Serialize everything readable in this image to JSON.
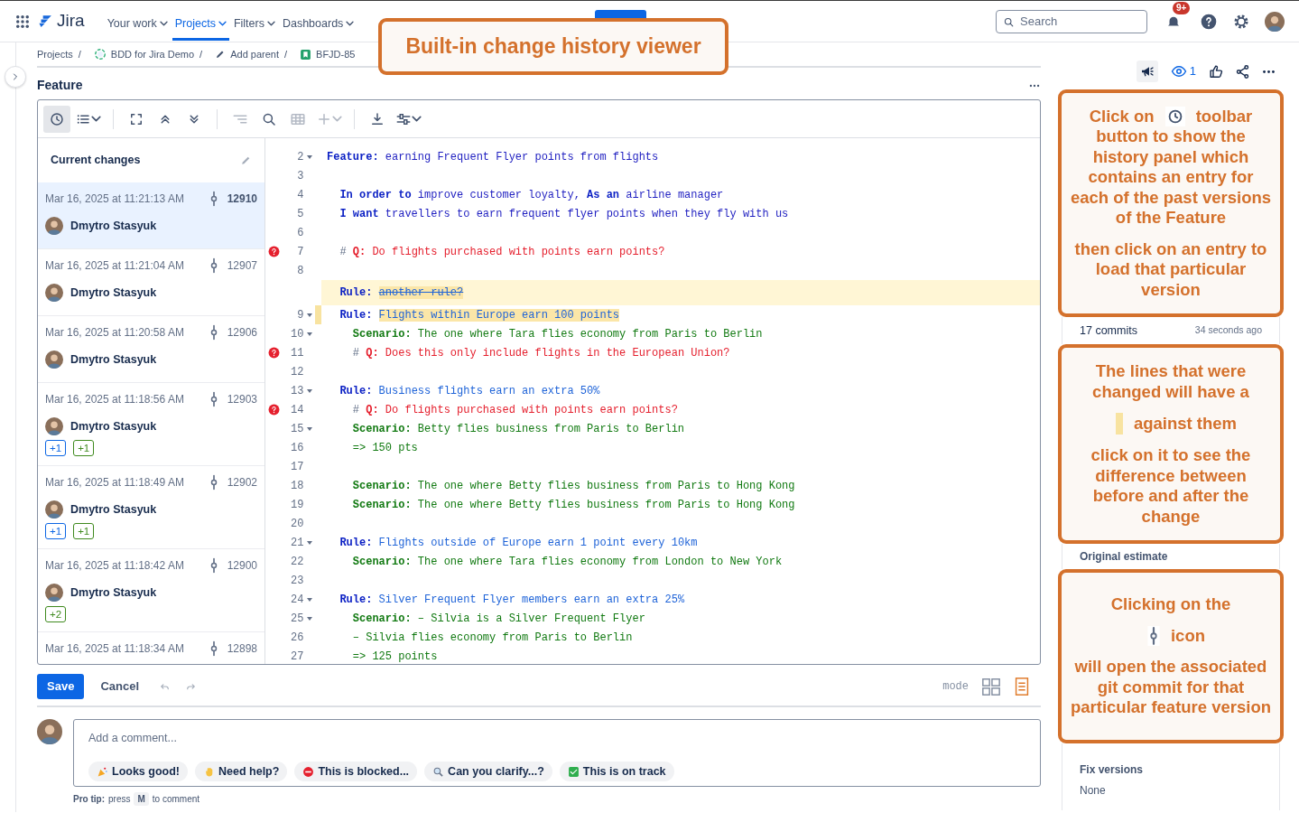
{
  "nav": {
    "app_name": "Jira",
    "items": [
      {
        "label": "Your work",
        "selected": false
      },
      {
        "label": "Projects",
        "selected": true
      },
      {
        "label": "Filters",
        "selected": false
      },
      {
        "label": "Dashboards",
        "selected": false
      }
    ],
    "search": {
      "placeholder": "Search"
    },
    "notifications_badge": "9+"
  },
  "top_callout": "Built-in change history viewer",
  "breadcrumbs": [
    {
      "kind": "plain",
      "label": "Projects",
      "separator": "/"
    },
    {
      "kind": "project",
      "label": "BDD for Jira Demo",
      "separator": "/"
    },
    {
      "kind": "edit",
      "label": "Add parent",
      "separator": "/"
    },
    {
      "kind": "issue",
      "label": "BFJD-85"
    }
  ],
  "issue_type": "Feature",
  "toolbar": [
    {
      "kind": "history",
      "selected": true,
      "disabled": false
    },
    {
      "kind": "list",
      "selected": false,
      "disabled": false
    },
    {
      "kind": "separator"
    },
    {
      "kind": "expand",
      "selected": false,
      "disabled": false
    },
    {
      "kind": "collapse-all",
      "selected": false,
      "disabled": false
    },
    {
      "kind": "expand-all",
      "selected": false,
      "disabled": false
    },
    {
      "kind": "separator"
    },
    {
      "kind": "outline",
      "selected": false,
      "disabled": true
    },
    {
      "kind": "search",
      "selected": false,
      "disabled": false
    },
    {
      "kind": "table",
      "selected": false,
      "disabled": true
    },
    {
      "kind": "add",
      "selected": false,
      "disabled": true
    },
    {
      "kind": "separator"
    },
    {
      "kind": "download",
      "selected": false,
      "disabled": false
    },
    {
      "kind": "settings",
      "selected": false,
      "disabled": false
    }
  ],
  "history": {
    "title": "Current changes",
    "entries": [
      {
        "date": "Mar 16, 2025 at 11:21:13 AM",
        "commit": "12910",
        "author": "Dmytro Stasyuk",
        "selected": true
      },
      {
        "date": "Mar 16, 2025 at 11:21:04 AM",
        "commit": "12907",
        "author": "Dmytro Stasyuk",
        "selected": false
      },
      {
        "date": "Mar 16, 2025 at 11:20:58 AM",
        "commit": "12906",
        "author": "Dmytro Stasyuk",
        "selected": false
      },
      {
        "date": "Mar 16, 2025 at 11:18:56 AM",
        "commit": "12903",
        "author": "Dmytro Stasyuk",
        "selected": false,
        "badges": [
          {
            "text": "+1",
            "color": "#0c66e4"
          },
          {
            "text": "+1",
            "color": "#3f8a1e"
          }
        ]
      },
      {
        "date": "Mar 16, 2025 at 11:18:49 AM",
        "commit": "12902",
        "author": "Dmytro Stasyuk",
        "selected": false,
        "badges": [
          {
            "text": "+1",
            "color": "#0c66e4"
          },
          {
            "text": "+1",
            "color": "#3f8a1e"
          }
        ]
      },
      {
        "date": "Mar 16, 2025 at 11:18:42 AM",
        "commit": "12900",
        "author": "Dmytro Stasyuk",
        "selected": false,
        "badges": [
          {
            "text": "+2",
            "color": "#3f8a1e"
          }
        ]
      },
      {
        "date": "Mar 16, 2025 at 11:18:34 AM",
        "commit": "12898",
        "selected": false
      }
    ]
  },
  "lines": [
    {
      "kind": "line",
      "number": "2",
      "foldable": true,
      "question": false,
      "changed": false,
      "segments": [
        {
          "kind": "keyword",
          "text": "Feature:"
        },
        {
          "kind": "title",
          "text": " earning Frequent Flyer points from flights"
        }
      ]
    },
    {
      "kind": "line",
      "number": "3",
      "foldable": false,
      "question": false,
      "changed": false
    },
    {
      "kind": "line",
      "number": "4",
      "foldable": false,
      "question": false,
      "changed": false,
      "segments": [
        {
          "kind": "keyword",
          "text": "  In order to"
        },
        {
          "kind": "title",
          "text": " improve customer loyalty,"
        },
        {
          "kind": "keyword",
          "text": " As an"
        },
        {
          "kind": "title",
          "text": " airline manager"
        }
      ]
    },
    {
      "kind": "line",
      "number": "5",
      "foldable": false,
      "question": false,
      "changed": false,
      "segments": [
        {
          "kind": "keyword",
          "text": "  I want"
        },
        {
          "kind": "title",
          "text": " travellers to earn frequent flyer points when they fly with us"
        }
      ]
    },
    {
      "kind": "line",
      "number": "6",
      "foldable": false,
      "question": false,
      "changed": false
    },
    {
      "kind": "line",
      "number": "7",
      "foldable": false,
      "question": true,
      "changed": false,
      "segments": [
        {
          "kind": "hash",
          "text": "  # "
        },
        {
          "kind": "question-keyword",
          "text": "Q:"
        },
        {
          "kind": "question",
          "text": " Do flights purchased with points earn points?"
        }
      ]
    },
    {
      "kind": "line",
      "number": "8",
      "foldable": false,
      "question": false,
      "changed": false
    },
    {
      "kind": "removed",
      "foldable": false,
      "question": false,
      "changed": false,
      "segments": [
        {
          "kind": "keyword",
          "text": "  Rule: "
        },
        {
          "kind": "rule",
          "text": "another rule?",
          "marked": true,
          "struck": true
        }
      ]
    },
    {
      "kind": "line",
      "number": "9",
      "foldable": true,
      "question": false,
      "changed": true,
      "segments": [
        {
          "kind": "keyword",
          "text": "  Rule: "
        },
        {
          "kind": "rule",
          "text": "Flights within Europe earn 100 points",
          "marked": true,
          "struck": false
        }
      ]
    },
    {
      "kind": "line",
      "number": "10",
      "foldable": true,
      "question": false,
      "changed": false,
      "segments": [
        {
          "kind": "scenario-keyword",
          "text": "    Scenario:"
        },
        {
          "kind": "scenario",
          "text": " The one where Tara flies economy from Paris to Berlin"
        }
      ]
    },
    {
      "kind": "line",
      "number": "11",
      "foldable": false,
      "question": true,
      "changed": false,
      "segments": [
        {
          "kind": "hash",
          "text": "    # "
        },
        {
          "kind": "question-keyword",
          "text": "Q:"
        },
        {
          "kind": "question",
          "text": " Does this only include flights in the European Union?"
        }
      ]
    },
    {
      "kind": "line",
      "number": "12",
      "foldable": false,
      "question": false,
      "changed": false
    },
    {
      "kind": "line",
      "number": "13",
      "foldable": true,
      "question": false,
      "changed": false,
      "segments": [
        {
          "kind": "keyword",
          "text": "  Rule:"
        },
        {
          "kind": "rule",
          "text": " Business flights earn an extra 50%"
        }
      ]
    },
    {
      "kind": "line",
      "number": "14",
      "foldable": false,
      "question": true,
      "changed": false,
      "segments": [
        {
          "kind": "hash",
          "text": "    # "
        },
        {
          "kind": "question-keyword",
          "text": "Q:"
        },
        {
          "kind": "question",
          "text": " Do flights purchased with points earn points?"
        }
      ]
    },
    {
      "kind": "line",
      "number": "15",
      "foldable": true,
      "question": false,
      "changed": false,
      "segments": [
        {
          "kind": "scenario-keyword",
          "text": "    Scenario:"
        },
        {
          "kind": "scenario",
          "text": " Betty flies business from Paris to Berlin"
        }
      ]
    },
    {
      "kind": "line",
      "number": "16",
      "foldable": false,
      "question": false,
      "changed": false,
      "segments": [
        {
          "kind": "scenario",
          "text": "    => 150 pts"
        }
      ]
    },
    {
      "kind": "line",
      "number": "17",
      "foldable": false,
      "question": false,
      "changed": false
    },
    {
      "kind": "line",
      "number": "18",
      "foldable": false,
      "question": false,
      "changed": false,
      "segments": [
        {
          "kind": "scenario-keyword",
          "text": "    Scenario:"
        },
        {
          "kind": "scenario",
          "text": " The one where Betty flies business from Paris to Hong Kong"
        }
      ]
    },
    {
      "kind": "line",
      "number": "19",
      "foldable": false,
      "question": false,
      "changed": false,
      "segments": [
        {
          "kind": "scenario-keyword",
          "text": "    Scenario:"
        },
        {
          "kind": "scenario",
          "text": " The one where Betty flies business from Paris to Hong Kong"
        }
      ]
    },
    {
      "kind": "line",
      "number": "20",
      "foldable": false,
      "question": false,
      "changed": false
    },
    {
      "kind": "line",
      "number": "21",
      "foldable": true,
      "question": false,
      "changed": false,
      "segments": [
        {
          "kind": "keyword",
          "text": "  Rule:"
        },
        {
          "kind": "rule",
          "text": " Flights outside of Europe earn 1 point every 10km"
        }
      ]
    },
    {
      "kind": "line",
      "number": "22",
      "foldable": false,
      "question": false,
      "changed": false,
      "segments": [
        {
          "kind": "scenario-keyword",
          "text": "    Scenario:"
        },
        {
          "kind": "scenario",
          "text": " The one where Tara flies economy from London to New York"
        }
      ]
    },
    {
      "kind": "line",
      "number": "23",
      "foldable": false,
      "question": false,
      "changed": false
    },
    {
      "kind": "line",
      "number": "24",
      "foldable": true,
      "question": false,
      "changed": false,
      "segments": [
        {
          "kind": "keyword",
          "text": "  Rule:"
        },
        {
          "kind": "rule",
          "text": " Silver Frequent Flyer members earn an extra 25%"
        }
      ]
    },
    {
      "kind": "line",
      "number": "25",
      "foldable": true,
      "question": false,
      "changed": false,
      "segments": [
        {
          "kind": "scenario-keyword",
          "text": "    Scenario:"
        },
        {
          "kind": "scenario",
          "text": " – Silvia is a Silver Frequent Flyer"
        }
      ]
    },
    {
      "kind": "line",
      "number": "26",
      "foldable": false,
      "question": false,
      "changed": false,
      "segments": [
        {
          "kind": "scenario",
          "text": "    – Silvia flies economy from Paris to Berlin"
        }
      ]
    },
    {
      "kind": "line",
      "number": "27",
      "foldable": false,
      "question": false,
      "changed": false,
      "segments": [
        {
          "kind": "scenario",
          "text": "    => 125 points"
        }
      ]
    }
  ],
  "editor_footer": {
    "save": "Save",
    "cancel": "Cancel",
    "mode_label": "mode",
    "modes": [
      {
        "kind": "split",
        "selected": false
      },
      {
        "kind": "document",
        "selected": true
      }
    ]
  },
  "comment": {
    "placeholder": "Add a comment...",
    "quick_replies": [
      {
        "kind": "party",
        "text": "Looks good!"
      },
      {
        "kind": "wave",
        "text": "Need help?"
      },
      {
        "kind": "blocked",
        "text": "This is blocked..."
      },
      {
        "kind": "magnifier",
        "text": "Can you clarify...?"
      },
      {
        "kind": "check",
        "text": "This is on track"
      }
    ],
    "pro_tip": {
      "label": "Pro tip:",
      "before": "press",
      "key": "M",
      "after": "to comment"
    }
  },
  "side": {
    "watchers": "1",
    "commits": "17 commits",
    "commits_time": "34 seconds ago",
    "original_estimate": "Original estimate",
    "fix_versions": {
      "label": "Fix versions",
      "value": "None"
    }
  },
  "callouts": [
    [
      [
        {
          "kind": "text",
          "text": "Click on"
        },
        {
          "kind": "toolbar-icon"
        },
        {
          "kind": "text",
          "text": "toolbar"
        },
        {
          "kind": "break"
        },
        {
          "kind": "text",
          "text": "button to show the history panel which contains an entry for each of the past versions of the Feature"
        }
      ],
      [
        {
          "kind": "text",
          "text": "then click on an entry to load that particular version"
        }
      ]
    ],
    [
      [
        {
          "kind": "text",
          "text": "The lines that were changed will have a"
        }
      ],
      [
        {
          "kind": "change-marker"
        },
        {
          "kind": "text",
          "text": "against them"
        }
      ],
      [
        {
          "kind": "text",
          "text": "click on it to see the difference between before and after the change"
        }
      ]
    ],
    [
      [
        {
          "kind": "text",
          "text": "Clicking on the"
        }
      ],
      [
        {
          "kind": "commit-icon"
        },
        {
          "kind": "text",
          "text": "icon"
        }
      ],
      [
        {
          "kind": "text",
          "text": "will open the associated git commit for that particular feature version"
        }
      ]
    ]
  ]
}
